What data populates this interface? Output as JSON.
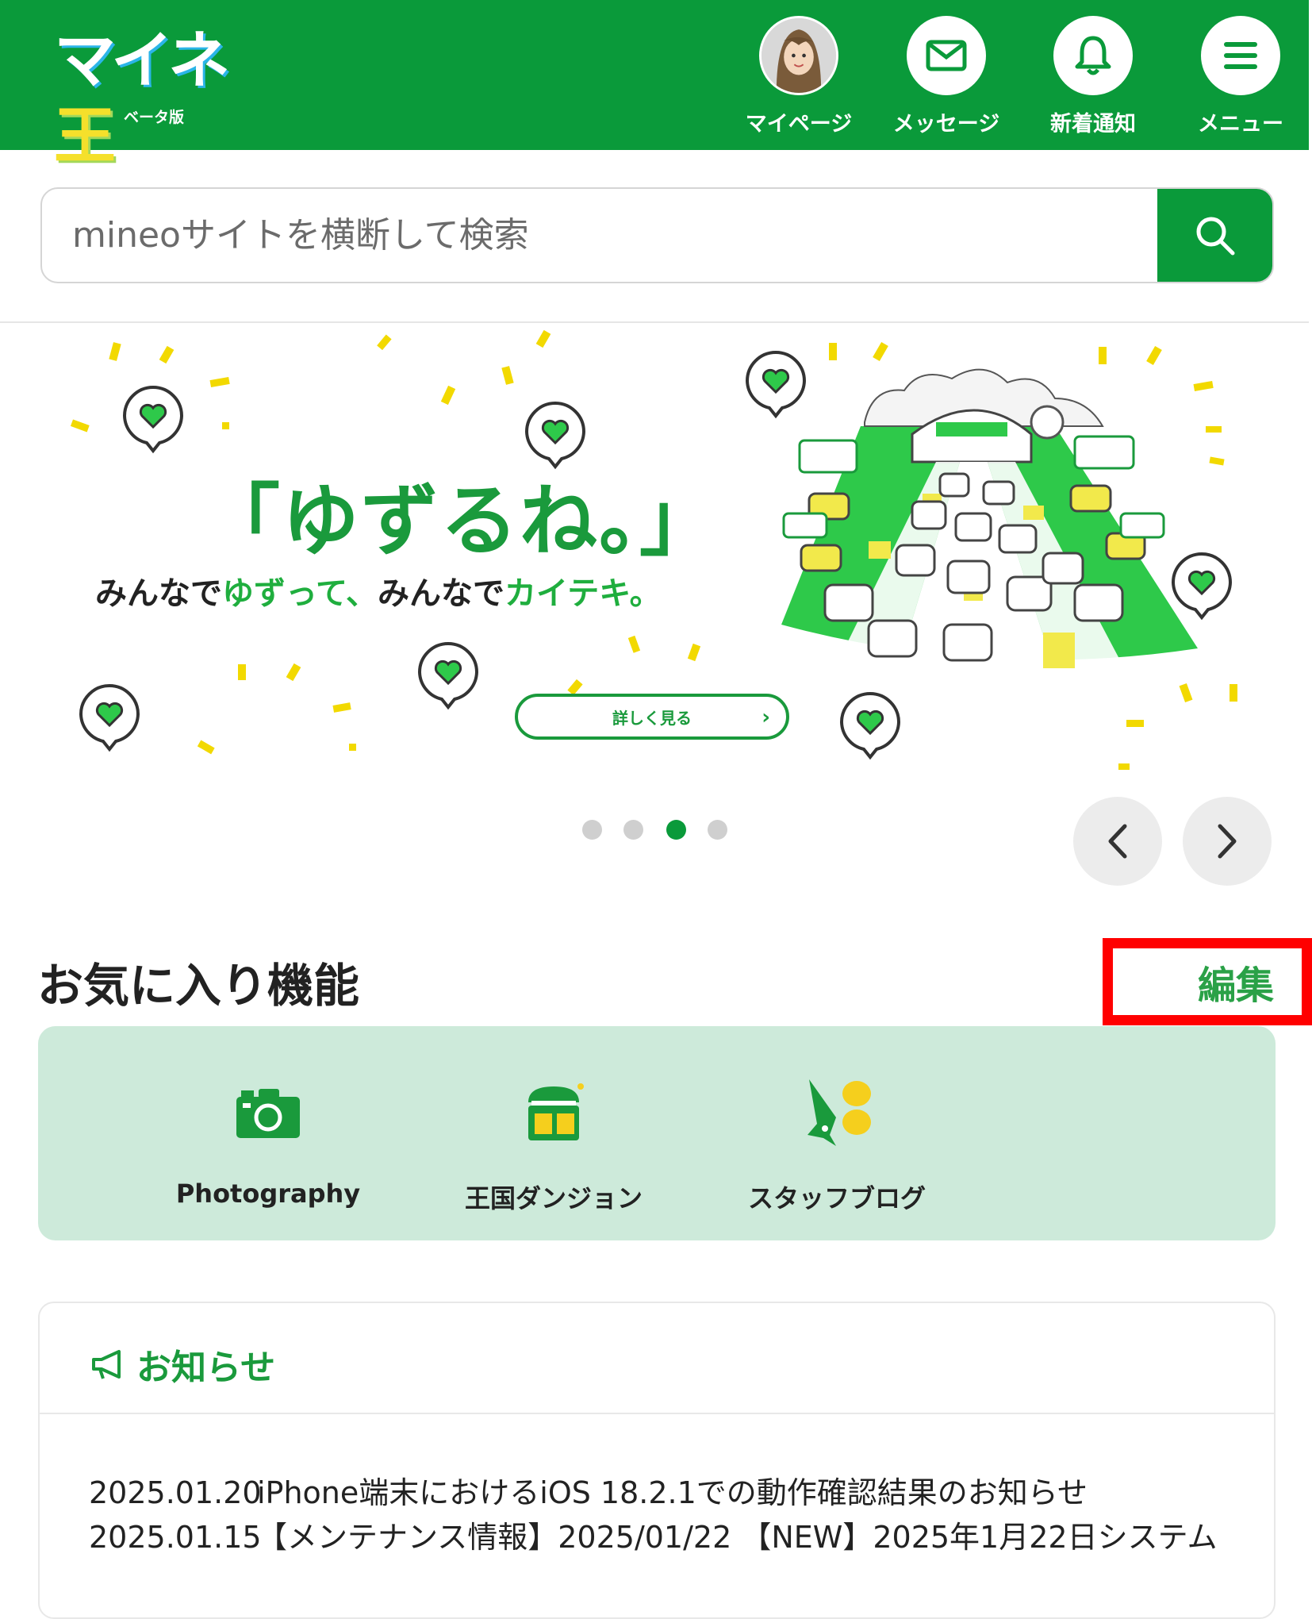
{
  "header": {
    "logo_main": "マイネ",
    "logo_tama": "王",
    "logo_sub": "ベータ版",
    "nav": [
      {
        "label": "マイページ",
        "icon": "avatar"
      },
      {
        "label": "メッセージ",
        "icon": "envelope-icon"
      },
      {
        "label": "新着通知",
        "icon": "bell-icon"
      },
      {
        "label": "メニュー",
        "icon": "hamburger-icon"
      }
    ]
  },
  "search": {
    "placeholder": "mineoサイトを横断して検索"
  },
  "banner": {
    "title": "「ゆずるね。」",
    "sub_1": "みんなで",
    "sub_2": "ゆずって、",
    "sub_3": "みんなで",
    "sub_4": "カイテキ。",
    "button_label": "詳しく見る",
    "slide_count": 4,
    "active_slide": 3
  },
  "favorites": {
    "title": "お気に入り機能",
    "edit_label": "編集",
    "items": [
      {
        "label": "Photography",
        "icon": "camera-icon"
      },
      {
        "label": "王国ダンジョン",
        "icon": "treasure-chest-icon"
      },
      {
        "label": "スタッフブログ",
        "icon": "pen-nib-icon"
      }
    ]
  },
  "notices": {
    "title": "お知らせ",
    "items": [
      {
        "date": "2025.01.20",
        "text": "iPhone端末におけるiOS 18.2.1での動作確認結果のお知らせ"
      },
      {
        "date": "2025.01.15",
        "text": "【メンテナンス情報】2025/01/22 【NEW】2025年1月22日システム"
      }
    ]
  },
  "colors": {
    "brand_green": "#0a9a3a",
    "favorites_bg": "#cdeada",
    "highlight_red": "#ff0000"
  }
}
